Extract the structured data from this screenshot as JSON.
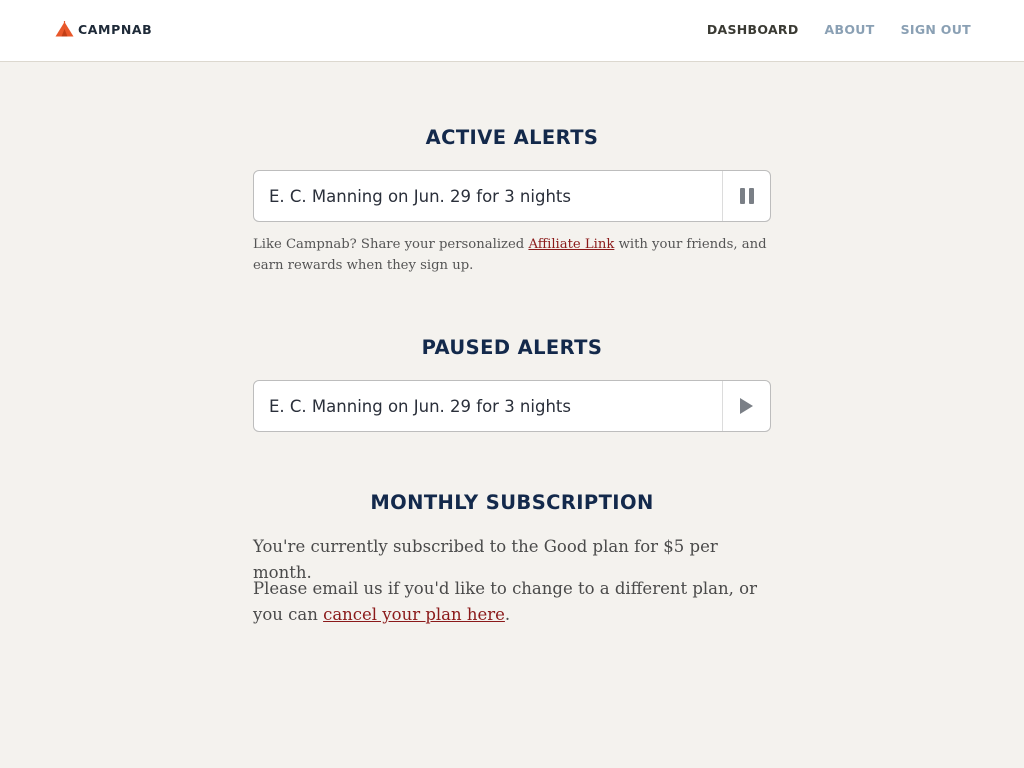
{
  "brand": {
    "name": "CAMPNAB",
    "logo_icon": "tent-icon",
    "accent": "#e8572a"
  },
  "nav": {
    "items": [
      {
        "label": "DASHBOARD",
        "active": true
      },
      {
        "label": "ABOUT",
        "active": false
      },
      {
        "label": "SIGN OUT",
        "active": false
      }
    ]
  },
  "active_alerts": {
    "title": "ACTIVE ALERTS",
    "alerts": [
      {
        "text": "E. C. Manning on Jun. 29 for 3 nights",
        "action_icon": "pause-icon"
      }
    ],
    "affiliate_note": {
      "before": "Like Campnab? Share your personalized ",
      "link": "Affiliate Link",
      "after": " with your friends, and earn rewards when they sign up."
    }
  },
  "paused_alerts": {
    "title": "PAUSED ALERTS",
    "alerts": [
      {
        "text": "E. C. Manning on Jun. 29 for 3 nights",
        "action_icon": "play-icon"
      }
    ]
  },
  "subscription": {
    "title": "MONTHLY SUBSCRIPTION",
    "status": "You're currently subscribed to the Good plan for $5 per month.",
    "change_before": "Please email us if you'd like to change to a different plan, or you can ",
    "cancel_link": "cancel your plan here",
    "change_after": "."
  },
  "colors": {
    "title": "#13294b",
    "link": "#8b1a1a",
    "nav_inactive": "#8aa0b4",
    "background": "#f4f2ee"
  }
}
